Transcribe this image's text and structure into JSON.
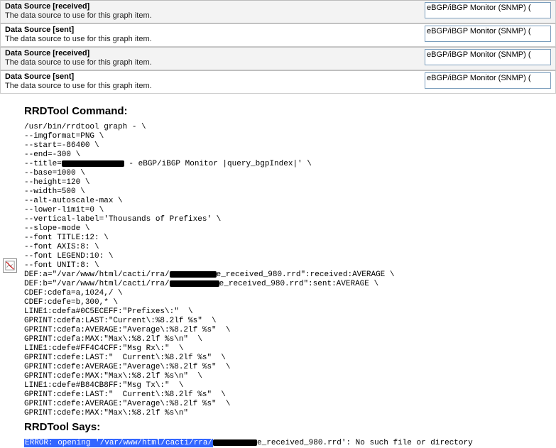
{
  "rows": [
    {
      "title": "Data Source [received]",
      "desc": "The data source to use for this graph item.",
      "select": "eBGP/iBGP Monitor (SNMP) (",
      "bg": "light"
    },
    {
      "title": "Data Source [sent]",
      "desc": "The data source to use for this graph item.",
      "select": "eBGP/iBGP Monitor (SNMP) (",
      "bg": "white"
    },
    {
      "title": "Data Source [received]",
      "desc": "The data source to use for this graph item.",
      "select": "eBGP/iBGP Monitor (SNMP) (",
      "bg": "light"
    },
    {
      "title": "Data Source [sent]",
      "desc": "The data source to use for this graph item.",
      "select": "eBGP/iBGP Monitor (SNMP) (",
      "bg": "white"
    }
  ],
  "headings": {
    "cmd": "RRDTool Command:",
    "says": "RRDTool Says:"
  },
  "cmd": {
    "l0": "/usr/bin/rrdtool graph - \\",
    "l1": "--imgformat=PNG \\",
    "l2": "--start=-86400 \\",
    "l3": "--end=-300 \\",
    "l4a": "--title=",
    "l4b": " - eBGP/iBGP Monitor |query_bgpIndex|' \\",
    "l5": "--base=1000 \\",
    "l6": "--height=120 \\",
    "l7": "--width=500 \\",
    "l8": "--alt-autoscale-max \\",
    "l9": "--lower-limit=0 \\",
    "l10": "--vertical-label='Thousands of Prefixes' \\",
    "l11": "--slope-mode \\",
    "l12": "--font TITLE:12: \\",
    "l13": "--font AXIS:8: \\",
    "l14": "--font LEGEND:10: \\",
    "l15": "--font UNIT:8: \\",
    "l16a": "DEF:a=\"/var/www/html/cacti/rra/",
    "l16b": "e_received_980.rrd\":received:AVERAGE \\",
    "l17a": "DEF:b=\"/var/www/html/cacti/rra/",
    "l17b": "e_received_980.rrd\":sent:AVERAGE \\",
    "l18": "CDEF:cdefa=a,1024,/ \\",
    "l19": "CDEF:cdefe=b,300,* \\",
    "l20": "LINE1:cdefa#0C5ECEFF:\"Prefixes\\:\"  \\",
    "l21": "GPRINT:cdefa:LAST:\"Current\\:%8.2lf %s\"  \\",
    "l22": "GPRINT:cdefa:AVERAGE:\"Average\\:%8.2lf %s\"  \\",
    "l23": "GPRINT:cdefa:MAX:\"Max\\:%8.2lf %s\\n\"  \\",
    "l24": "LINE1:cdefe#FF4C4CFF:\"Msg Rx\\:\"  \\",
    "l25": "GPRINT:cdefe:LAST:\"  Current\\:%8.2lf %s\"  \\",
    "l26": "GPRINT:cdefe:AVERAGE:\"Average\\:%8.2lf %s\"  \\",
    "l27": "GPRINT:cdefe:MAX:\"Max\\:%8.2lf %s\\n\"  \\",
    "l28": "LINE1:cdefe#B84CB8FF:\"Msg Tx\\:\"  \\",
    "l29": "GPRINT:cdefe:LAST:\"  Current\\:%8.2lf %s\"  \\",
    "l30": "GPRINT:cdefe:AVERAGE:\"Average\\:%8.2lf %s\"  \\",
    "l31": "GPRINT:cdefe:MAX:\"Max\\:%8.2lf %s\\n\""
  },
  "error": {
    "a": "ERROR: opening '/var/www/html/cacti/rra/",
    "b": "e_received_980.rrd': No such file or directory"
  }
}
